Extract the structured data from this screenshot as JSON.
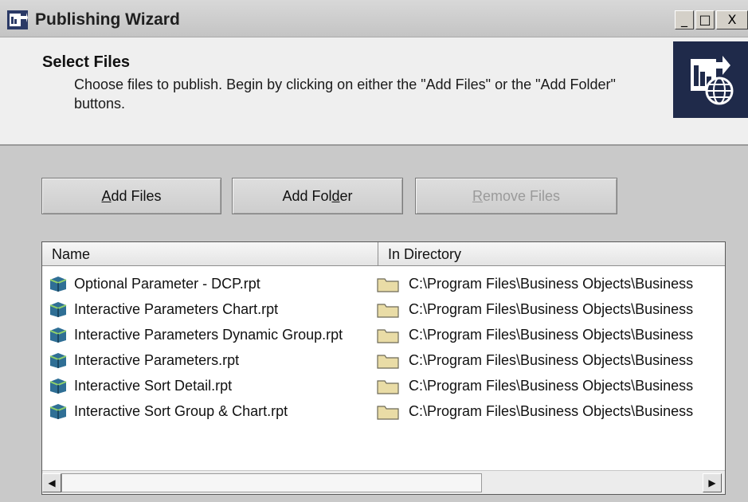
{
  "window": {
    "title": "Publishing Wizard",
    "controls": {
      "minimize": "_",
      "maximize": "□",
      "close": "X"
    }
  },
  "header": {
    "step_title": "Select Files",
    "description": "Choose files to publish.  Begin by clicking on either the \"Add Files\" or the \"Add Folder\" buttons.",
    "logo_icon": "publish-globe-icon"
  },
  "buttons": {
    "add_files": {
      "label_prefix": "",
      "mnemonic": "A",
      "label_suffix": "dd Files"
    },
    "add_folder": {
      "label_prefix": "Add Fol",
      "mnemonic": "d",
      "label_suffix": "er"
    },
    "remove_files": {
      "label_prefix": "",
      "mnemonic": "R",
      "label_suffix": "emove Files",
      "enabled": false
    }
  },
  "list": {
    "columns": [
      "Name",
      "In Directory"
    ],
    "rows": [
      {
        "name": "Optional Parameter - DCP.rpt",
        "directory": "C:\\Program Files\\Business Objects\\Business"
      },
      {
        "name": "Interactive Parameters Chart.rpt",
        "directory": "C:\\Program Files\\Business Objects\\Business"
      },
      {
        "name": "Interactive Parameters Dynamic Group.rpt",
        "directory": "C:\\Program Files\\Business Objects\\Business"
      },
      {
        "name": "Interactive Parameters.rpt",
        "directory": "C:\\Program Files\\Business Objects\\Business"
      },
      {
        "name": "Interactive Sort Detail.rpt",
        "directory": "C:\\Program Files\\Business Objects\\Business"
      },
      {
        "name": "Interactive Sort Group & Chart.rpt",
        "directory": "C:\\Program Files\\Business Objects\\Business"
      }
    ],
    "scroll_left": "◀",
    "scroll_right": "▶"
  },
  "colors": {
    "window_bg": "#c9c9c9",
    "header_bg": "#efefef",
    "logo_bg": "#1f2a4a",
    "folder": "#e9dca6"
  }
}
